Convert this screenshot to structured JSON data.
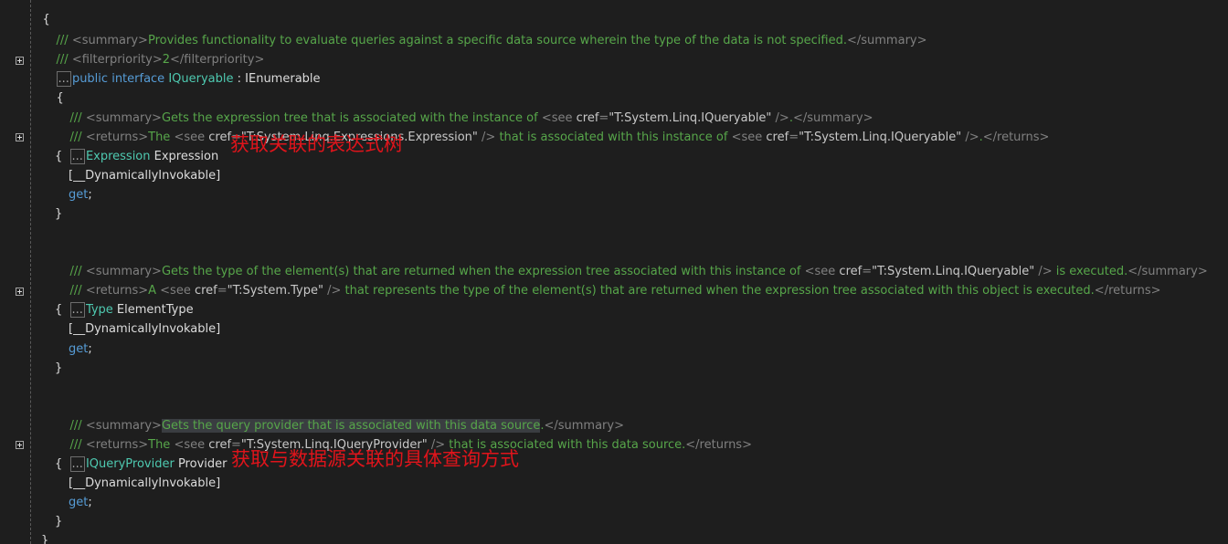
{
  "colors": {
    "background": "#1e1e1e",
    "comment": "#57a64a",
    "xml_tag": "#808080",
    "keyword": "#569cd6",
    "type": "#4ec9b0",
    "identifier": "#dcdcdc",
    "annotation": "#e0141b"
  },
  "code": {
    "line1_brace": "{",
    "l2": {
      "slashes": "/// ",
      "open_tag": "<summary>",
      "text": "Provides functionality to evaluate queries against a specific data source wherein the type of the data is not specified.",
      "close_tag": "</summary>"
    },
    "l3": {
      "slashes": "/// ",
      "open_tag": "<filterpriority>",
      "text": "2",
      "close_tag": "</filterpriority>"
    },
    "l4": {
      "collapsed": "...",
      "kw1": "public",
      "kw2": "interface",
      "name": "IQueryable",
      "colon": " : ",
      "base": "IEnumerable"
    },
    "l5": "{",
    "l6": {
      "slashes": "/// ",
      "open_tag": "<summary>",
      "text": "Gets the expression tree that is associated with the instance of ",
      "see_open": "<see ",
      "cref": "cref",
      "eq": "=",
      "value": "\"T:System.Linq.IQueryable\"",
      "see_close": " />",
      "tail": ".",
      "close_tag": "</summary>"
    },
    "l7": {
      "slashes": "/// ",
      "open_tag": "<returns>",
      "text1": "The ",
      "see1_open": "<see ",
      "cref1": "cref",
      "eq1": "=",
      "value1": "\"T:System.Linq.Expressions.Expression\"",
      "see1_close": " />",
      "text2": " that is associated with this instance of ",
      "see2_open": "<see ",
      "cref2": "cref",
      "eq2": "=",
      "value2": "\"T:System.Linq.IQueryable\"",
      "see2_close": " />",
      "tail": ".",
      "close_tag": "</returns>"
    },
    "l8": {
      "collapsed": "...",
      "type": "Expression",
      "name": " Expression"
    },
    "l9": "{",
    "l10": "[__DynamicallyInvokable]",
    "l11": {
      "kw": "get",
      "semi": ";"
    },
    "l12": "}",
    "l14": {
      "slashes": "/// ",
      "open_tag": "<summary>",
      "text": "Gets the type of the element(s) that are returned when the expression tree associated with this instance of ",
      "see_open": "<see ",
      "cref": "cref",
      "eq": "=",
      "value": "\"T:System.Linq.IQueryable\"",
      "see_close": " />",
      "tail": " is executed.",
      "close_tag": "</summary>"
    },
    "l15": {
      "slashes": "/// ",
      "open_tag": "<returns>",
      "text1": "A ",
      "see_open": "<see ",
      "cref": "cref",
      "eq": "=",
      "value": "\"T:System.Type\"",
      "see_close": " />",
      "text2": " that represents the type of the element(s) that are returned when the expression tree associated with this object is executed.",
      "close_tag": "</returns>"
    },
    "l16": {
      "collapsed": "...",
      "type": "Type",
      "name": " ElementType"
    },
    "l17": "{",
    "l18": "[__DynamicallyInvokable]",
    "l19": {
      "kw": "get",
      "semi": ";"
    },
    "l20": "}",
    "l22": {
      "slashes": "/// ",
      "open_tag": "<summary>",
      "text": "Gets the query provider that is associated with this data source",
      "tail": ".",
      "close_tag": "</summary>"
    },
    "l23": {
      "slashes": "/// ",
      "open_tag": "<returns>",
      "text1": "The ",
      "see_open": "<see ",
      "cref": "cref",
      "eq": "=",
      "value": "\"T:System.Linq.IQueryProvider\"",
      "see_close": " />",
      "text2": " that is associated with this data source.",
      "close_tag": "</returns>"
    },
    "l24": {
      "collapsed": "...",
      "type": "IQueryProvider",
      "name": " Provider"
    },
    "l25": "{",
    "l26": "[__DynamicallyInvokable]",
    "l27": {
      "kw": "get",
      "semi": ";"
    },
    "l28": "}",
    "l29": "}"
  },
  "annotations": {
    "expression": "获取关联的表达式树",
    "provider": "获取与数据源关联的具体查询方式"
  }
}
